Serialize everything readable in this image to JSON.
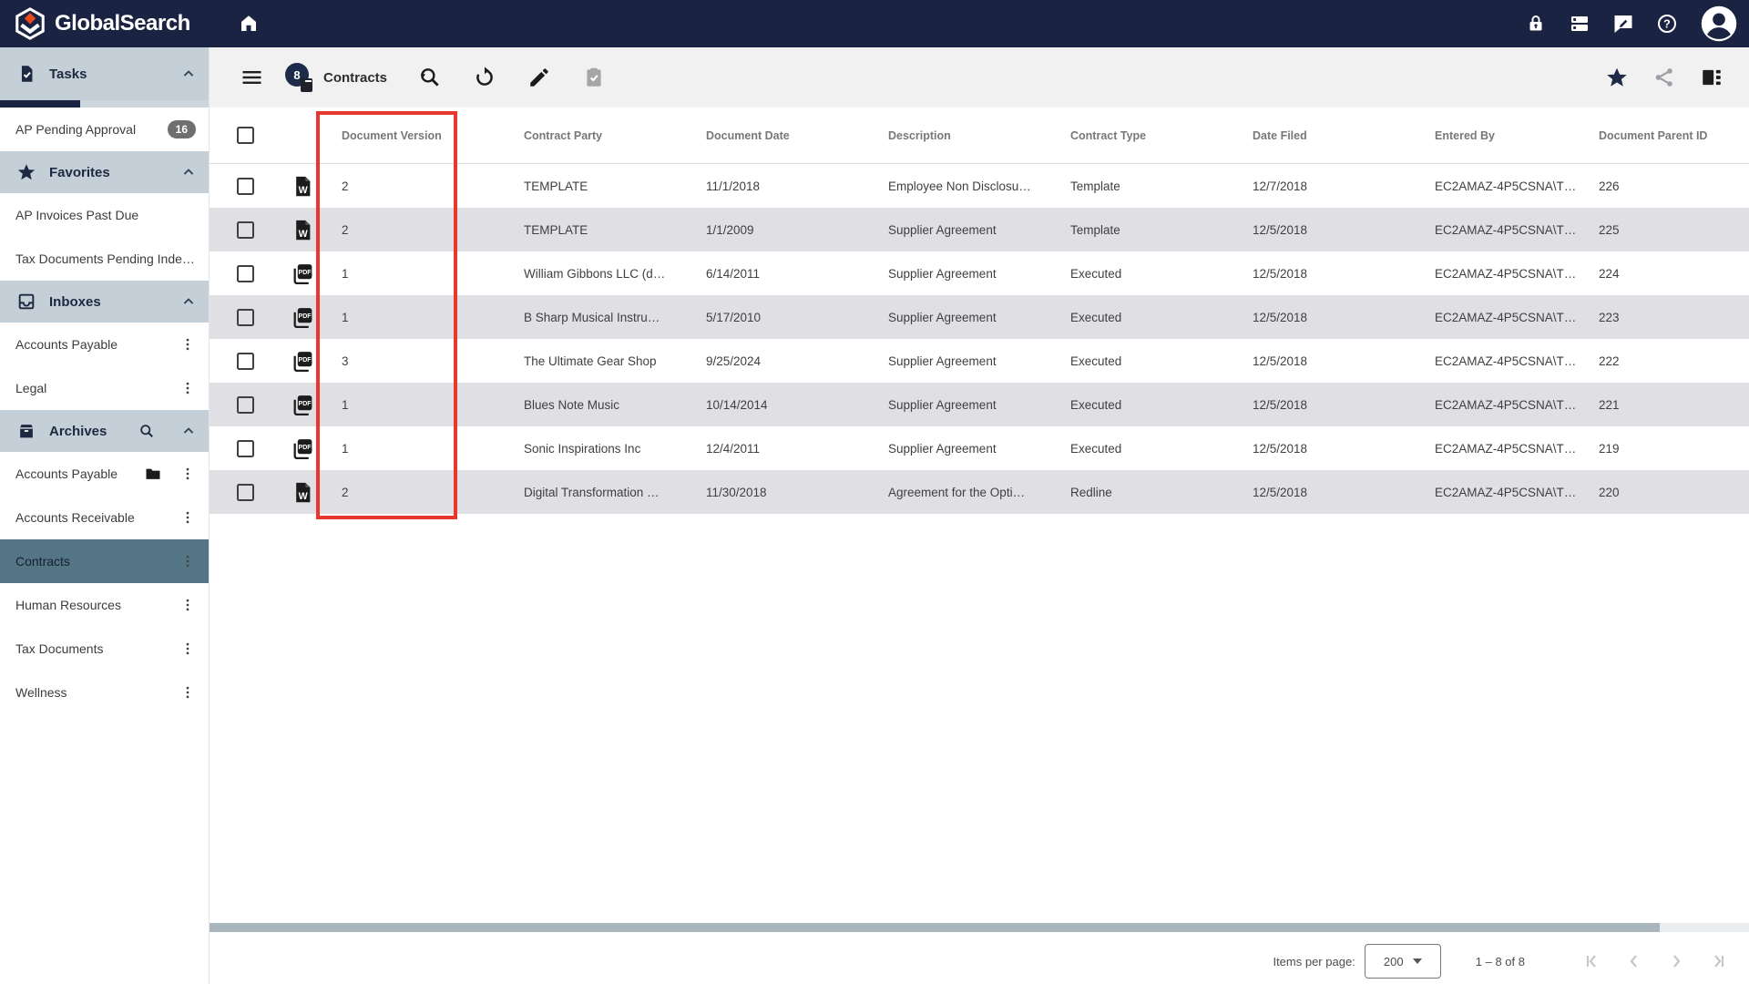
{
  "topbar": {
    "brand": "GlobalSearch",
    "icons": [
      "hexagon-logo",
      "home-icon",
      "lock-icon",
      "server-list-icon",
      "feedback-chat-icon",
      "help-icon",
      "user-avatar-icon"
    ]
  },
  "sidebar": {
    "tasks": {
      "header": "Tasks",
      "icon": "task-document-icon",
      "items": [
        {
          "label": "AP Pending Approval",
          "badge": "16"
        }
      ]
    },
    "favorites": {
      "header": "Favorites",
      "icon": "star-icon",
      "items": [
        {
          "label": "AP Invoices Past Due"
        },
        {
          "label": "Tax Documents Pending Inde…"
        }
      ]
    },
    "inboxes": {
      "header": "Inboxes",
      "icon": "inbox-icon",
      "items": [
        {
          "label": "Accounts Payable"
        },
        {
          "label": "Legal"
        }
      ]
    },
    "archives": {
      "header": "Archives",
      "icon": "archive-icon",
      "has_search": true,
      "items": [
        {
          "label": "Accounts Payable",
          "has_folder": true
        },
        {
          "label": "Accounts Receivable"
        },
        {
          "label": "Contracts",
          "selected": true
        },
        {
          "label": "Human Resources"
        },
        {
          "label": "Tax Documents"
        },
        {
          "label": "Wellness"
        }
      ]
    }
  },
  "toolbar": {
    "title": "Contracts",
    "result_count": "8",
    "left_icons": [
      "hamburger-menu-icon",
      "result-count-badge",
      "search-again-icon",
      "refresh-icon",
      "edit-pencil-icon",
      "clipboard-check-icon-disabled"
    ],
    "right_icons": [
      "favorite-star-icon",
      "share-icon",
      "view-column-icon"
    ]
  },
  "table": {
    "columns": [
      "Document Version",
      "Contract Party",
      "Document Date",
      "Description",
      "Contract Type",
      "Date Filed",
      "Entered By",
      "Document Parent ID"
    ],
    "rows": [
      {
        "file_icon": "word-document-icon",
        "version": "2",
        "party": "TEMPLATE",
        "date": "11/1/2018",
        "desc": "Employee Non Disclosu…",
        "type": "Template",
        "filed": "12/7/2018",
        "by": "EC2AMAZ-4P5CSNA\\T…",
        "pid": "226"
      },
      {
        "file_icon": "word-document-icon",
        "version": "2",
        "party": "TEMPLATE",
        "date": "1/1/2009",
        "desc": "Supplier Agreement",
        "type": "Template",
        "filed": "12/5/2018",
        "by": "EC2AMAZ-4P5CSNA\\T…",
        "pid": "225"
      },
      {
        "file_icon": "pdf-document-icon",
        "version": "1",
        "party": "William Gibbons LLC (d…",
        "date": "6/14/2011",
        "desc": "Supplier Agreement",
        "type": "Executed",
        "filed": "12/5/2018",
        "by": "EC2AMAZ-4P5CSNA\\T…",
        "pid": "224"
      },
      {
        "file_icon": "pdf-document-icon",
        "version": "1",
        "party": "B Sharp Musical Instru…",
        "date": "5/17/2010",
        "desc": "Supplier Agreement",
        "type": "Executed",
        "filed": "12/5/2018",
        "by": "EC2AMAZ-4P5CSNA\\T…",
        "pid": "223"
      },
      {
        "file_icon": "pdf-document-icon",
        "version": "3",
        "party": "The Ultimate Gear Shop",
        "date": "9/25/2024",
        "desc": "Supplier Agreement",
        "type": "Executed",
        "filed": "12/5/2018",
        "by": "EC2AMAZ-4P5CSNA\\T…",
        "pid": "222"
      },
      {
        "file_icon": "pdf-document-icon",
        "version": "1",
        "party": "Blues Note Music",
        "date": "10/14/2014",
        "desc": "Supplier Agreement",
        "type": "Executed",
        "filed": "12/5/2018",
        "by": "EC2AMAZ-4P5CSNA\\T…",
        "pid": "221"
      },
      {
        "file_icon": "pdf-document-icon",
        "version": "1",
        "party": "Sonic Inspirations Inc",
        "date": "12/4/2011",
        "desc": "Supplier Agreement",
        "type": "Executed",
        "filed": "12/5/2018",
        "by": "EC2AMAZ-4P5CSNA\\T…",
        "pid": "219"
      },
      {
        "file_icon": "word-document-icon",
        "version": "2",
        "party": "Digital Transformation …",
        "date": "11/30/2018",
        "desc": "Agreement for the Opti…",
        "type": "Redline",
        "filed": "12/5/2018",
        "by": "EC2AMAZ-4P5CSNA\\T…",
        "pid": "220"
      }
    ]
  },
  "annotation": {
    "highlighted_column": "Document Version",
    "color": "#e8372c"
  },
  "pagination": {
    "items_per_page_label": "Items per page:",
    "items_per_page": "200",
    "range": "1 – 8 of 8",
    "nav_icons": [
      "first-page-icon",
      "previous-page-icon",
      "next-page-icon",
      "last-page-icon"
    ]
  },
  "colors": {
    "topbar": "#1a2342",
    "section_header": "#c5cfd7",
    "selected_item": "#547585",
    "row_stripe": "#e0e0e4",
    "annotation_red": "#e8372c"
  }
}
